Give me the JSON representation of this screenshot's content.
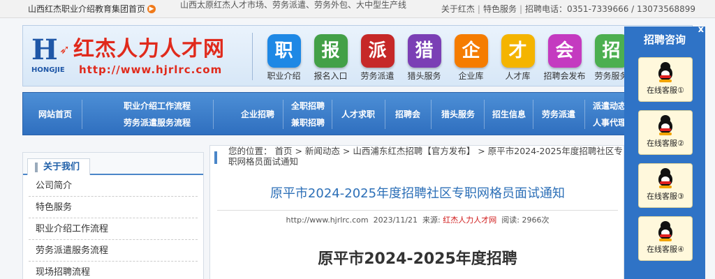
{
  "topbar": {
    "home_link": "山西红杰职业介绍教育集团首页",
    "tagline": "山西太原红杰人才市场、劳务派遣、劳务外包、大中型生产线",
    "about": "关于红杰",
    "services": "特色服务",
    "phone": "招聘电话：0351-7339666 / 13073568899"
  },
  "logo": {
    "letter": "H",
    "name": "红杰人力人才网",
    "sub": "HONGJIE",
    "url": "http://www.hjrlrc.com"
  },
  "nav_icons": [
    {
      "char": "职",
      "label": "职业介绍",
      "color": "#1e88e5"
    },
    {
      "char": "报",
      "label": "报名入口",
      "color": "#43a047"
    },
    {
      "char": "派",
      "label": "劳务派遣",
      "color": "#c62828"
    },
    {
      "char": "猎",
      "label": "猎头服务",
      "color": "#7b3fb5"
    },
    {
      "char": "企",
      "label": "企业库",
      "color": "#f57c00"
    },
    {
      "char": "才",
      "label": "人才库",
      "color": "#f4b400"
    },
    {
      "char": "会",
      "label": "招聘会发布",
      "color": "#c43ac0"
    },
    {
      "char": "招",
      "label": "劳务服务",
      "color": "#4caf50"
    }
  ],
  "navbar": {
    "home": "网站首页",
    "process1": "职业介绍工作流程",
    "process2": "劳务派遣服务流程",
    "recruit": "企业招聘",
    "fulltime": "全职招聘",
    "parttime": "兼职招聘",
    "jobseek": "人才求职",
    "fair": "招聘会",
    "headhunt": "猎头服务",
    "info": "招生信息",
    "labor": "劳务派遣",
    "news": "派遣动态",
    "hr": "人事代理"
  },
  "sidebar": {
    "title": "关于我们",
    "items": [
      "公司简介",
      "特色服务",
      "职业介绍工作流程",
      "劳务派遣服务流程",
      "现场招聘流程"
    ]
  },
  "article": {
    "breadcrumb": "您的位置： 首页 > 新闻动态 > 山西浦东红杰招聘【官方发布】 > 原平市2024-2025年度招聘社区专职网格员面试通知",
    "title": "原平市2024-2025年度招聘社区专职网格员面试通知",
    "url": "http://www.hjrlrc.com",
    "date": "2023/11/21",
    "source_label": "来源:",
    "source": "红杰人力人才网",
    "views_label": "阅读:",
    "views": "2966次",
    "body_heading": "原平市2024-2025年度招聘"
  },
  "consult": {
    "close": "x",
    "title": "招聘咨询",
    "agents": [
      "在线客服①",
      "在线客服②",
      "在线客服③",
      "在线客服④"
    ]
  }
}
